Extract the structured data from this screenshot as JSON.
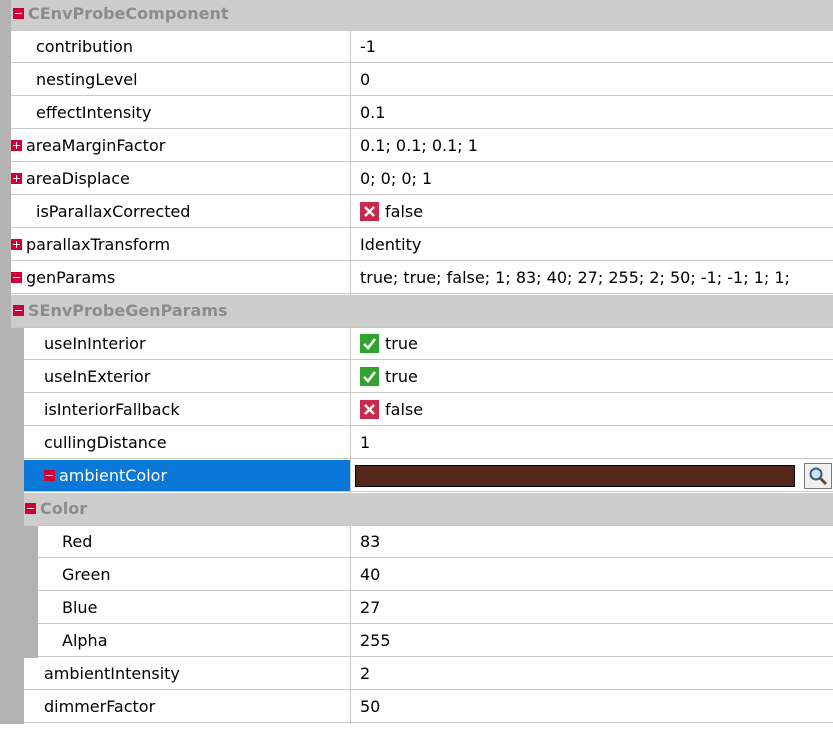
{
  "rows": [
    {
      "kind": "header",
      "depth": 0,
      "label": "CEnvProbeComponent"
    },
    {
      "kind": "prop",
      "depth": 0,
      "name": "contribution",
      "value": "-1"
    },
    {
      "kind": "prop",
      "depth": 0,
      "name": "nestingLevel",
      "value": "0"
    },
    {
      "kind": "prop",
      "depth": 0,
      "name": "effectIntensity",
      "value": "0.1"
    },
    {
      "kind": "prop",
      "depth": 0,
      "name": "areaMarginFactor",
      "value": "0.1; 0.1; 0.1; 1",
      "expander": "plus"
    },
    {
      "kind": "prop",
      "depth": 0,
      "name": "areaDisplace",
      "value": "0; 0; 0; 1",
      "expander": "plus"
    },
    {
      "kind": "prop",
      "depth": 0,
      "name": "isParallaxCorrected",
      "value": "false",
      "bool": false
    },
    {
      "kind": "prop",
      "depth": 0,
      "name": "parallaxTransform",
      "value": "Identity",
      "expander": "plus"
    },
    {
      "kind": "prop",
      "depth": 0,
      "name": "genParams",
      "value": "true; true; false; 1; 83; 40; 27; 255; 2; 50; -1; -1; 1; 1;",
      "expander": "minus"
    },
    {
      "kind": "header",
      "depth": 1,
      "label": "SEnvProbeGenParams"
    },
    {
      "kind": "prop",
      "depth": 1,
      "name": "useInInterior",
      "value": "true",
      "bool": true
    },
    {
      "kind": "prop",
      "depth": 1,
      "name": "useInExterior",
      "value": "true",
      "bool": true
    },
    {
      "kind": "prop",
      "depth": 1,
      "name": "isInteriorFallback",
      "value": "false",
      "bool": false
    },
    {
      "kind": "prop",
      "depth": 1,
      "name": "cullingDistance",
      "value": "1"
    },
    {
      "kind": "prop",
      "depth": 1,
      "name": "ambientColor",
      "value": "",
      "expander": "minus",
      "selected": true,
      "color": "#53281b"
    },
    {
      "kind": "header",
      "depth": 2,
      "label": "Color"
    },
    {
      "kind": "prop",
      "depth": 2,
      "name": "Red",
      "value": "83"
    },
    {
      "kind": "prop",
      "depth": 2,
      "name": "Green",
      "value": "40"
    },
    {
      "kind": "prop",
      "depth": 2,
      "name": "Blue",
      "value": "27"
    },
    {
      "kind": "prop",
      "depth": 2,
      "name": "Alpha",
      "value": "255"
    },
    {
      "kind": "prop",
      "depth": 1,
      "name": "ambientIntensity",
      "value": "2"
    },
    {
      "kind": "prop",
      "depth": 1,
      "name": "dimmerFactor",
      "value": "50"
    }
  ],
  "icons": {
    "expander_minus": "minus-box-icon",
    "expander_plus": "plus-box-icon",
    "bool_true": "check-icon",
    "bool_false": "cross-icon",
    "color_picker": "magnifier-icon"
  },
  "colors": {
    "expander": "#d00037",
    "selection": "#0a78d8",
    "header_bg": "#cdcdcd",
    "header_text": "#8c8c8c",
    "check": "#30a42f",
    "cross": "#c72a4b"
  }
}
